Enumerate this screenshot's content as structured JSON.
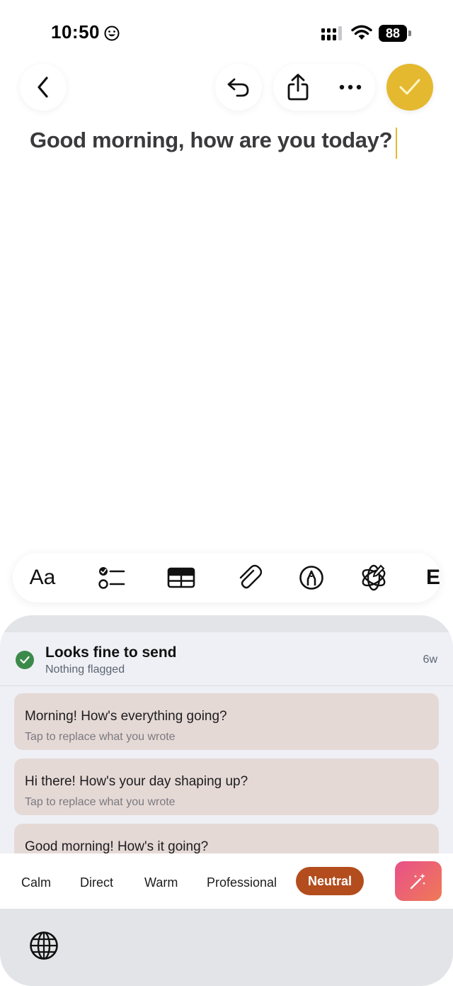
{
  "status_bar": {
    "time": "10:50",
    "battery": "88",
    "icons": [
      "smiley-icon",
      "signal-icon",
      "wifi-icon",
      "battery-icon"
    ]
  },
  "top_bar": {
    "icons": [
      "chevron-left-icon",
      "undo-icon",
      "share-icon",
      "more-horizontal-icon",
      "checkmark-icon"
    ],
    "done_color": "#e4b930"
  },
  "note": {
    "text": "Good morning, how are you today?"
  },
  "format_toolbar": {
    "text_format_label": "Aa",
    "overflow_label": "E",
    "icons": [
      "text-format-icon",
      "checklist-icon",
      "table-icon",
      "paperclip-icon",
      "markup-icon",
      "apple-intelligence-icon"
    ]
  },
  "writing_panel": {
    "summary": {
      "title": "Looks fine to send",
      "subtitle": "Nothing flagged",
      "age": "6w"
    },
    "suggestions": [
      {
        "text": "Morning! How's everything going?",
        "hint": "Tap to replace what you wrote"
      },
      {
        "text": "Hi there! How's your day shaping up?",
        "hint": "Tap to replace what you wrote"
      },
      {
        "text": "Good morning! How's it going?"
      }
    ],
    "tones": [
      "Calm",
      "Direct",
      "Warm",
      "Professional",
      "Neutral"
    ],
    "selected_tone": "Neutral",
    "selected_tone_color": "#b34d1d"
  },
  "keyboard": {
    "icons": [
      "globe-icon",
      "magic-wand-icon"
    ]
  }
}
